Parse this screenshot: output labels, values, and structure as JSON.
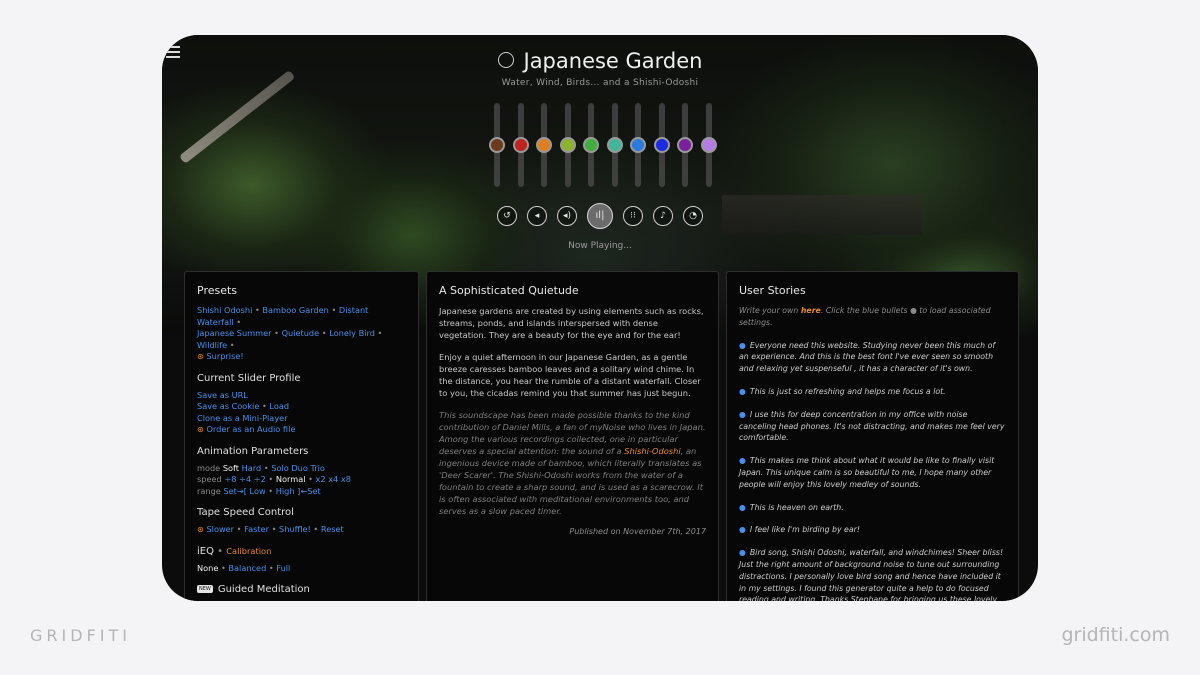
{
  "app": {
    "title": "Japanese Garden",
    "subtitle": "Water, Wind, Birds... and a Shishi-Odoshi",
    "now_playing": "Now Playing..."
  },
  "sliders": [
    {
      "color": "#6b3a1a",
      "level": 0.5
    },
    {
      "color": "#c0221c",
      "level": 0.5
    },
    {
      "color": "#e07f1f",
      "level": 0.5
    },
    {
      "color": "#8bb32d",
      "level": 0.5
    },
    {
      "color": "#3fae3f",
      "level": 0.5
    },
    {
      "color": "#3fb59a",
      "level": 0.5
    },
    {
      "color": "#2a7ae0",
      "level": 0.5
    },
    {
      "color": "#1a2ae6",
      "level": 0.5
    },
    {
      "color": "#7a1f9e",
      "level": 0.5
    },
    {
      "color": "#b67be6",
      "level": 0.5
    }
  ],
  "controls": [
    {
      "name": "reset-icon",
      "glyph": "↺"
    },
    {
      "name": "volume-down-icon",
      "glyph": "◂"
    },
    {
      "name": "volume-up-icon",
      "glyph": "◂)"
    },
    {
      "name": "equalizer-icon",
      "glyph": "ıl|"
    },
    {
      "name": "animate-icon",
      "glyph": "⁝⁝"
    },
    {
      "name": "bell-icon",
      "glyph": "♪"
    },
    {
      "name": "timer-icon",
      "glyph": "◔"
    }
  ],
  "presets": {
    "title": "Presets",
    "items": [
      "Shishi Odoshi",
      "Bamboo Garden",
      "Distant Waterfall",
      "Japanese Summer",
      "Quietude",
      "Lonely Bird",
      "Wildlife"
    ],
    "surprise": "Surprise!"
  },
  "slider_profile": {
    "title": "Current Slider Profile",
    "save_url": "Save as URL",
    "save_cookie": "Save as Cookie",
    "load": "Load",
    "clone": "Clone as a Mini-Player",
    "order": "Order as an Audio file"
  },
  "animation": {
    "title": "Animation Parameters",
    "mode_label": "mode",
    "mode_soft": "Soft",
    "mode_hard": "Hard",
    "mode_solo": "Solo",
    "mode_duo": "Duo",
    "mode_trio": "Trio",
    "speed_label": "speed",
    "speed_d8": "÷8",
    "speed_d4": "÷4",
    "speed_d2": "÷2",
    "speed_normal": "Normal",
    "speed_x2": "x2",
    "speed_x4": "x4",
    "speed_x8": "x8",
    "range_label": "range",
    "range_set_from": "Set→[",
    "range_low": "Low",
    "range_high": "High",
    "range_set_to": "]←Set"
  },
  "tape": {
    "title": "Tape Speed Control",
    "slower": "Slower",
    "faster": "Faster",
    "shuffle": "Shuffle!",
    "reset": "Reset"
  },
  "ieq": {
    "title": "iEQ",
    "calibration": "Calibration",
    "none": "None",
    "balanced": "Balanced",
    "full": "Full"
  },
  "meditation": {
    "badge": "NEW",
    "title": "Guided Meditation"
  },
  "about": {
    "title": "A Sophisticated Quietude",
    "para1": "Japanese gardens are created by using elements such as rocks, streams, ponds, and islands interspersed with dense vegetation. They are a beauty for the eye and for the ear!",
    "para2": "Enjoy a quiet afternoon in our Japanese Garden, as a gentle breeze caresses bamboo leaves and a solitary wind chime. In the distance, you hear the rumble of a distant waterfall. Closer to you, the cicadas remind you that summer has just begun.",
    "para3_a": "This soundscape has been made possible thanks to the kind contribution of Daniel Mills, a fan of myNoise who lives in Japan. Among the various recordings collected, one in particular deserves a special attention: the sound of a ",
    "para3_link": "Shishi-Odoshi",
    "para3_b": ", an ingenious device made of bamboo, which literally translates as 'Deer Scarer'. The Shishi-Odoshi works from the water of a fountain to create a sharp sound, and is used as a scarecrow. It is often associated with meditational environments too, and serves as a slow paced timer.",
    "published": "Published on November 7th, 2017"
  },
  "stories": {
    "title": "User Stories",
    "intro_a": "Write your own ",
    "intro_link": "here",
    "intro_b": ". Click the blue bullets ● to load associated settings.",
    "items": [
      "Everyone need this website. Studying never been this much of an experience. And this is the best font I've ever seen so smooth and relaxing yet suspenseful , it has a character of it's own.",
      "This is just so refreshing and helps me focus a lot.",
      "I use this for deep concentration in my office with noise canceling head phones. It's not distracting, and makes me feel very comfortable.",
      "This makes me think about what it would be like to finally visit Japan. This unique calm is so beautiful to me, I hope many other people will enjoy this lovely medley of sounds.",
      "This is heaven on earth.",
      "I feel like I'm birding by ear!",
      "Bird song, Shishi Odoshi, waterfall, and windchimes! Sheer bliss! Just the right amount of background noise to tune out surrounding distractions. I personally love bird song and hence have included it in my settings. I found this generator quite a help to do focused reading and writing. Thanks Stephane for bringing us these lovely sounds!"
    ]
  },
  "branding": {
    "left": "GRIDFITI",
    "right": "gridfiti.com"
  }
}
